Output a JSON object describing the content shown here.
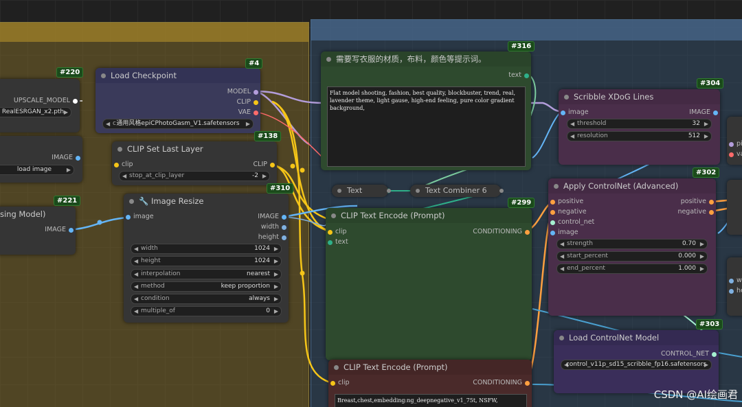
{
  "colors": {
    "model": "#b39ddb",
    "clip": "#f5c518",
    "vae": "#ff6b6b",
    "image": "#64b5f6",
    "conditioning": "#ffa040",
    "control_net": "#a5f0d0",
    "int": "#7fb0e0",
    "string": "#7dcea0",
    "upscale": "#ffffff"
  },
  "nodes": {
    "upscale": {
      "id": "#220",
      "output": "UPSCALE_MODEL",
      "value": "RealESRGAN_x2.pth"
    },
    "loadimage": {
      "output": "IMAGE",
      "button": "load image"
    },
    "n221": {
      "id": "#221",
      "title": "sing Model)",
      "output": "IMAGE"
    },
    "checkpoint": {
      "id": "#4",
      "title": "Load Checkpoint",
      "outputs": [
        "MODEL",
        "CLIP",
        "VAE"
      ],
      "ckpt_prefix": "c",
      "ckpt_value": "通用风格epiCPhotoGasm_V1.safetensors"
    },
    "cliplast": {
      "id": "#138",
      "title": "CLIP Set Last Layer",
      "input": "clip",
      "output": "CLIP",
      "widget_label": "stop_at_clip_layer",
      "widget_value": "-2"
    },
    "resize": {
      "id": "#310",
      "title": "Image Resize",
      "input": "image",
      "outputs": [
        "IMAGE",
        "width",
        "height"
      ],
      "widgets": [
        {
          "label": "width",
          "value": "1024"
        },
        {
          "label": "height",
          "value": "1024"
        },
        {
          "label": "interpolation",
          "value": "nearest"
        },
        {
          "label": "method",
          "value": "keep proportion"
        },
        {
          "label": "condition",
          "value": "always"
        },
        {
          "label": "multiple_of",
          "value": "0"
        }
      ]
    },
    "textnode": {
      "id": "#316",
      "title": "需要写衣服的材质，布料，颜色等提示词。",
      "output": "text",
      "text": "Flat model shooting, fashion, best quality, blockbuster, trend, real, lavender theme, light gause, high-end feeling, pure color gradient background,"
    },
    "text_mini": {
      "label": "Text"
    },
    "combiner": {
      "label": "Text Combiner 6"
    },
    "encode1": {
      "id": "#299",
      "title": "CLIP Text Encode (Prompt)",
      "inputs": [
        "clip",
        "text"
      ],
      "output": "CONDITIONING"
    },
    "encode2": {
      "title": "CLIP Text Encode (Prompt)",
      "input": "clip",
      "output": "CONDITIONING",
      "text": "Breast,chest,embedding:ng_deepnegative_v1_75t, NSFW,"
    },
    "xdog": {
      "id": "#304",
      "title": "Scribble XDoG Lines",
      "input": "image",
      "output": "IMAGE",
      "widgets": [
        {
          "label": "threshold",
          "value": "32"
        },
        {
          "label": "resolution",
          "value": "512"
        }
      ]
    },
    "controlnet": {
      "id": "#302",
      "title": "Apply ControlNet (Advanced)",
      "inputs": [
        "positive",
        "negative",
        "control_net",
        "image"
      ],
      "outputs": [
        "positive",
        "negative"
      ],
      "widgets": [
        {
          "label": "strength",
          "value": "0.70"
        },
        {
          "label": "start_percent",
          "value": "0.000"
        },
        {
          "label": "end_percent",
          "value": "1.000"
        }
      ]
    },
    "loadcn": {
      "id": "#303",
      "title": "Load ControlNet Model",
      "output": "CONTROL_NET",
      "value": "control_v11p_sd15_scribble_fp16.safetensors"
    },
    "edge": {
      "inputs": [
        "pi",
        "va"
      ],
      "inputs2": [
        "w",
        "he"
      ]
    }
  },
  "watermark": "CSDN @AI绘画君"
}
